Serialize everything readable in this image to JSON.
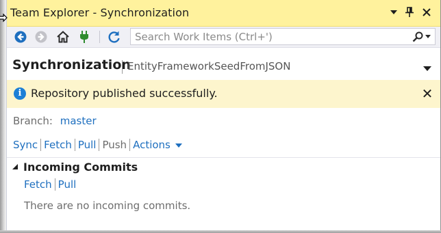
{
  "window": {
    "title": "Team Explorer - Synchronization"
  },
  "toolbar": {
    "search_placeholder": "Search Work Items (Ctrl+')",
    "icons": [
      "back-icon",
      "forward-icon",
      "home-icon",
      "connect-icon",
      "refresh-icon",
      "search-icon"
    ]
  },
  "page": {
    "title": "Synchronization",
    "repository": "EntityFrameworkSeedFromJSON"
  },
  "notification": {
    "message": "Repository published successfully.",
    "close_label": "✕"
  },
  "branch": {
    "label": "Branch:",
    "name": "master"
  },
  "actions": {
    "sync": "Sync",
    "fetch": "Fetch",
    "pull": "Pull",
    "push": "Push",
    "more": "Actions"
  },
  "incoming": {
    "title": "Incoming Commits",
    "fetch": "Fetch",
    "pull": "Pull",
    "empty_message": "There are no incoming commits."
  },
  "colors": {
    "titlebar": "#fff29d",
    "infobar": "#fdf5cd",
    "link": "#1e6fbf",
    "accent_blue": "#1c7fd6"
  }
}
